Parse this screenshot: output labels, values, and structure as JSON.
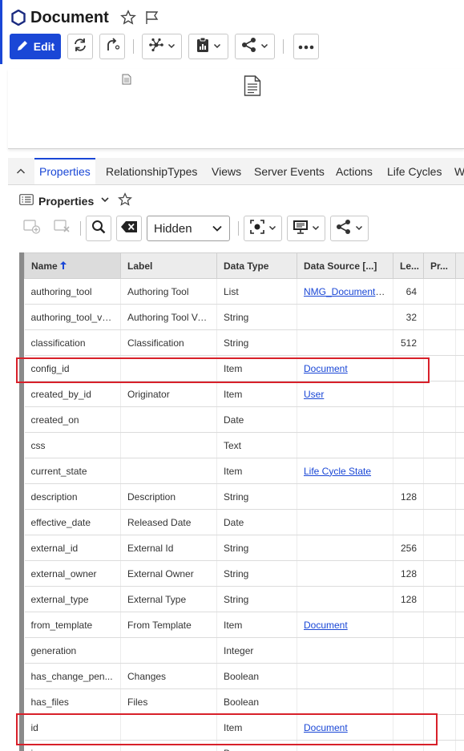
{
  "header": {
    "title": "Document",
    "edit_label": "Edit",
    "colors": {
      "accent": "#1a47d6",
      "highlight": "#d8202a"
    }
  },
  "tabs": [
    {
      "label": "Properties",
      "active": true
    },
    {
      "label": "RelationshipTypes"
    },
    {
      "label": "Views"
    },
    {
      "label": "Server Events"
    },
    {
      "label": "Actions"
    },
    {
      "label": "Life Cycles"
    },
    {
      "label": "W"
    }
  ],
  "properties_panel": {
    "title": "Properties",
    "filter": {
      "selected": "Hidden"
    }
  },
  "grid": {
    "columns": [
      {
        "label": "Name"
      },
      {
        "label": "Label"
      },
      {
        "label": "Data Type"
      },
      {
        "label": "Data Source [...]"
      },
      {
        "label": "Le..."
      },
      {
        "label": "Pr..."
      }
    ],
    "rows": [
      {
        "name": "authoring_tool",
        "label": "Authoring Tool",
        "type": "List",
        "source": "NMG_Document_...",
        "length": "64"
      },
      {
        "name": "authoring_tool_ve...",
        "label": "Authoring Tool Ve...",
        "type": "String",
        "source": "",
        "length": "32"
      },
      {
        "name": "classification",
        "label": "Classification",
        "type": "String",
        "source": "",
        "length": "512"
      },
      {
        "name": "config_id",
        "label": "",
        "type": "Item",
        "source": "Document",
        "length": "",
        "highlighted": true
      },
      {
        "name": "created_by_id",
        "label": "Originator",
        "type": "Item",
        "source": "User",
        "length": ""
      },
      {
        "name": "created_on",
        "label": "",
        "type": "Date",
        "source": "",
        "length": ""
      },
      {
        "name": "css",
        "label": "",
        "type": "Text",
        "source": "",
        "length": ""
      },
      {
        "name": "current_state",
        "label": "",
        "type": "Item",
        "source": "Life Cycle State",
        "length": ""
      },
      {
        "name": "description",
        "label": "Description",
        "type": "String",
        "source": "",
        "length": "128"
      },
      {
        "name": "effective_date",
        "label": "Released Date",
        "type": "Date",
        "source": "",
        "length": ""
      },
      {
        "name": "external_id",
        "label": "External Id",
        "type": "String",
        "source": "",
        "length": "256"
      },
      {
        "name": "external_owner",
        "label": "External Owner",
        "type": "String",
        "source": "",
        "length": "128"
      },
      {
        "name": "external_type",
        "label": "External Type",
        "type": "String",
        "source": "",
        "length": "128"
      },
      {
        "name": "from_template",
        "label": "From Template",
        "type": "Item",
        "source": "Document",
        "length": ""
      },
      {
        "name": "generation",
        "label": "",
        "type": "Integer",
        "source": "",
        "length": ""
      },
      {
        "name": "has_change_pen...",
        "label": "Changes",
        "type": "Boolean",
        "source": "",
        "length": ""
      },
      {
        "name": "has_files",
        "label": "Files",
        "type": "Boolean",
        "source": "",
        "length": ""
      },
      {
        "name": "id",
        "label": "",
        "type": "Item",
        "source": "Document",
        "length": "",
        "highlighted": true
      },
      {
        "name": "i...",
        "label": "",
        "type": "B...",
        "source": "",
        "length": ""
      }
    ]
  }
}
